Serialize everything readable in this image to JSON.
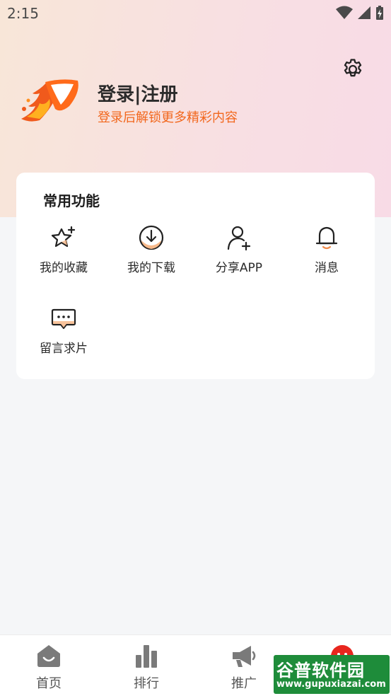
{
  "status_bar": {
    "time": "2:15"
  },
  "header": {
    "login_title": "登录|注册",
    "login_subtitle": "登录后解锁更多精彩内容"
  },
  "features": {
    "title": "常用功能",
    "items": [
      {
        "label": "我的收藏",
        "icon": "star-sparkle-icon"
      },
      {
        "label": "我的下载",
        "icon": "download-icon"
      },
      {
        "label": "分享APP",
        "icon": "user-add-icon"
      },
      {
        "label": "消息",
        "icon": "bell-icon"
      },
      {
        "label": "留言求片",
        "icon": "chat-bubble-icon"
      }
    ]
  },
  "bottom_nav": {
    "items": [
      {
        "label": "首页",
        "icon": "home-icon"
      },
      {
        "label": "排行",
        "icon": "bar-chart-icon"
      },
      {
        "label": "推广",
        "icon": "megaphone-icon"
      }
    ]
  },
  "watermark": {
    "title": "谷普软件园",
    "url": "www.gupuxiazai.com"
  },
  "colors": {
    "accent": "#f2671d",
    "watermark_green": "#1e8c3a",
    "badge_red": "#e8261e"
  }
}
